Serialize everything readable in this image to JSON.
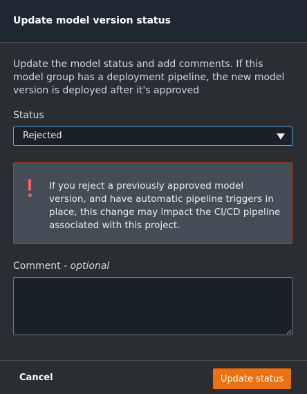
{
  "dialog": {
    "title": "Update model version status",
    "description": "Update the model status and add comments. If this model group has a deployment pipeline, the new model version is deployed after it's approved"
  },
  "status": {
    "label": "Status",
    "selected": "Rejected",
    "caret_icon": "caret-down-icon"
  },
  "alert": {
    "icon": "exclamation-icon",
    "color": "#d13212",
    "text": "If you reject a previously approved model version, and have automatic pipeline triggers in place, this change may impact the CI/CD pipeline associated with this project."
  },
  "comment": {
    "label": "Comment - ",
    "optional": "optional",
    "value": ""
  },
  "footer": {
    "cancel_label": "Cancel",
    "submit_label": "Update status",
    "submit_color": "#ec7211"
  }
}
